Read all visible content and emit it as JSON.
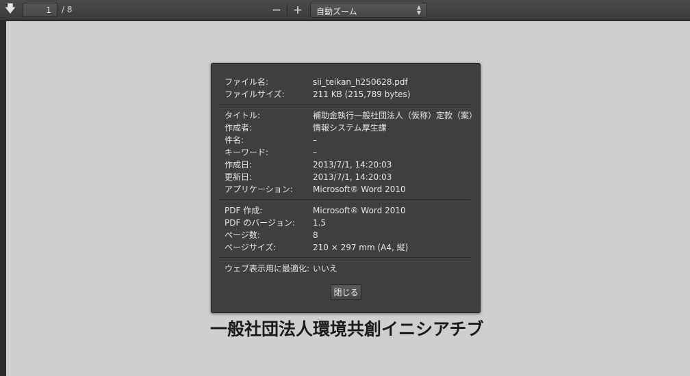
{
  "toolbar": {
    "download_icon": "arrow-down-icon",
    "page_current": "1",
    "page_total": "/ 8",
    "zoom_out": "−",
    "zoom_in": "+",
    "zoom_selected": "自動ズーム",
    "select_arrows": "⬍"
  },
  "document": {
    "heading": "一般社団法人環境共創イニシアチブ"
  },
  "properties": {
    "file": [
      {
        "label": "ファイル名:",
        "value": "sii_teikan_h250628.pdf"
      },
      {
        "label": "ファイルサイズ:",
        "value": "211 KB (215,789 bytes)"
      }
    ],
    "meta": [
      {
        "label": "タイトル:",
        "value": "補助金執行一般社団法人（仮称）定款（案）"
      },
      {
        "label": "作成者:",
        "value": "情報システム厚生課"
      },
      {
        "label": "件名:",
        "value": "–"
      },
      {
        "label": "キーワード:",
        "value": "–"
      },
      {
        "label": "作成日:",
        "value": "2013/7/1, 14:20:03"
      },
      {
        "label": "更新日:",
        "value": "2013/7/1, 14:20:03"
      },
      {
        "label": "アプリケーション:",
        "value": "Microsoft® Word 2010"
      }
    ],
    "pdf": [
      {
        "label": "PDF 作成:",
        "value": "Microsoft® Word 2010"
      },
      {
        "label": "PDF のバージョン:",
        "value": "1.5"
      },
      {
        "label": "ページ数:",
        "value": "8"
      },
      {
        "label": "ページサイズ:",
        "value": "210 × 297 mm (A4, 縦)"
      }
    ],
    "web": [
      {
        "label": "ウェブ表示用に最適化:",
        "value": "いいえ"
      }
    ],
    "close_label": "閉じる"
  }
}
